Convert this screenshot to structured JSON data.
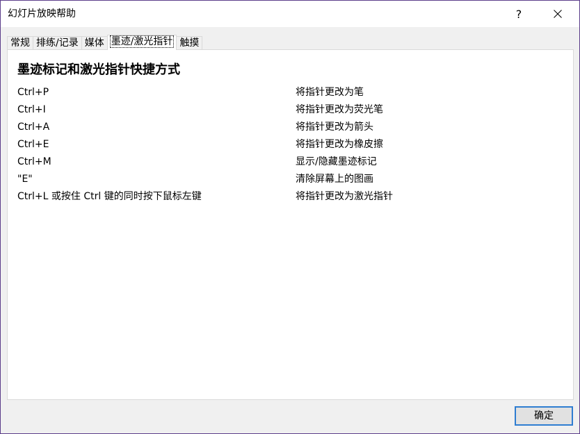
{
  "window": {
    "title": "幻灯片放映帮助",
    "help_label": "?",
    "close_icon": "close-icon"
  },
  "tabs": [
    {
      "label": "常规",
      "active": false
    },
    {
      "label": "排练/记录",
      "active": false
    },
    {
      "label": "媒体",
      "active": false
    },
    {
      "label": "墨迹/激光指针",
      "active": true
    },
    {
      "label": "触摸",
      "active": false
    }
  ],
  "panel": {
    "heading": "墨迹标记和激光指针快捷方式",
    "shortcuts": [
      {
        "key": "Ctrl+P",
        "desc": "将指针更改为笔"
      },
      {
        "key": "Ctrl+I",
        "desc": "将指针更改为荧光笔"
      },
      {
        "key": "Ctrl+A",
        "desc": "将指针更改为箭头"
      },
      {
        "key": "Ctrl+E",
        "desc": "将指针更改为橡皮擦"
      },
      {
        "key": "Ctrl+M",
        "desc": "显示/隐藏墨迹标记"
      },
      {
        "key": "\"E\"",
        "desc": "清除屏幕上的图画"
      },
      {
        "key": "Ctrl+L 或按住 Ctrl 键的同时按下鼠标左键",
        "desc": "将指针更改为激光指针"
      }
    ]
  },
  "footer": {
    "ok_label": "确定"
  },
  "colors": {
    "window_border": "#5b3d8a",
    "focus_border": "#2e7dd1"
  }
}
